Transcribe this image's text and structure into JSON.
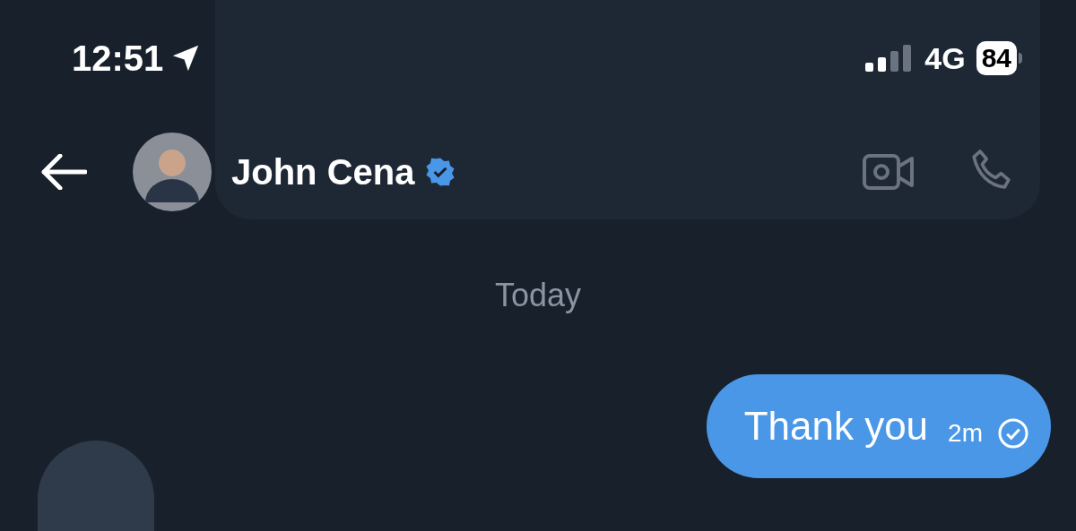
{
  "status_bar": {
    "time": "12:51",
    "network": "4G",
    "battery": "84"
  },
  "header": {
    "name": "John Cena",
    "verified": true
  },
  "date_divider": "Today",
  "messages": [
    {
      "kind": "sent",
      "text": "Thank you",
      "time": "2m"
    }
  ]
}
